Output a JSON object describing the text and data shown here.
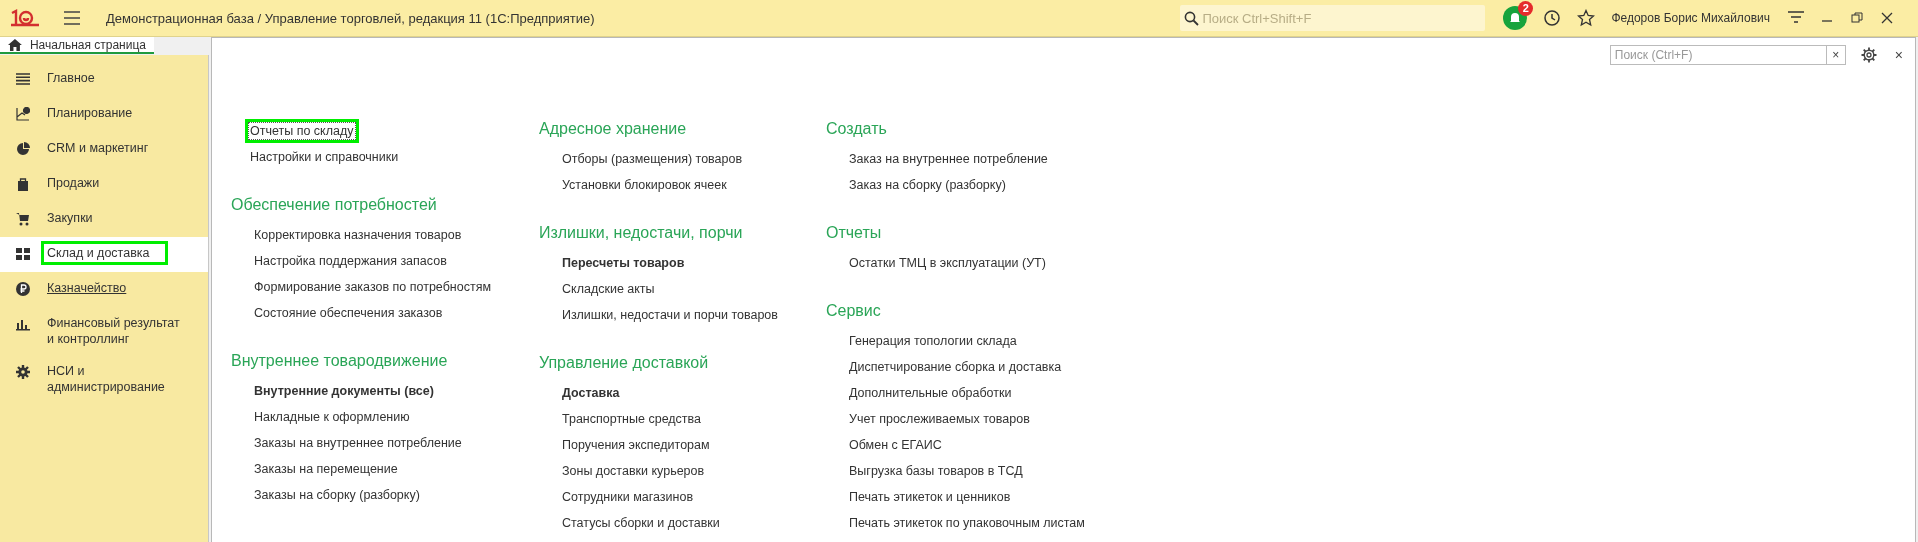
{
  "window": {
    "title": "Демонстрационная база / Управление торговлей, редакция 11  (1С:Предприятие)",
    "search_placeholder": "Поиск Ctrl+Shift+F",
    "notifications": "2",
    "user": "Федоров Борис Михайлович"
  },
  "home_tab": {
    "label": "Начальная страница",
    "selected": true
  },
  "sidebar": {
    "items": [
      {
        "label": "Главное",
        "selected": false,
        "highlighted": false,
        "underlined": false
      },
      {
        "label": "Планирование",
        "selected": false,
        "highlighted": false,
        "underlined": false
      },
      {
        "label": "CRM и маркетинг",
        "selected": false,
        "highlighted": false,
        "underlined": false
      },
      {
        "label": "Продажи",
        "selected": false,
        "highlighted": false,
        "underlined": false
      },
      {
        "label": "Закупки",
        "selected": false,
        "highlighted": false,
        "underlined": false
      },
      {
        "label": "Склад и доставка",
        "selected": true,
        "highlighted": true,
        "underlined": false
      },
      {
        "label": "Казначейство",
        "selected": false,
        "highlighted": false,
        "underlined": true
      },
      {
        "label": "Финансовый результат и контроллинг",
        "selected": false,
        "highlighted": false,
        "underlined": false
      },
      {
        "label": "НСИ и администрирование",
        "selected": false,
        "highlighted": false,
        "underlined": false
      }
    ]
  },
  "panel": {
    "search_placeholder": "Поиск (Ctrl+F)",
    "clear": "×",
    "close": "×",
    "columns": [
      [
        {
          "items": [
            {
              "label": "Отчеты по складу",
              "bold": false,
              "highlighted": true
            },
            {
              "label": "Настройки и справочники",
              "bold": false,
              "highlighted": false
            }
          ]
        },
        {
          "heading": "Обеспечение потребностей",
          "items": [
            {
              "label": "Корректировка назначения товаров",
              "bold": false,
              "highlighted": false
            },
            {
              "label": "Настройка поддержания запасов",
              "bold": false,
              "highlighted": false
            },
            {
              "label": "Формирование заказов по потребностям",
              "bold": false,
              "highlighted": false
            },
            {
              "label": "Состояние обеспечения заказов",
              "bold": false,
              "highlighted": false
            }
          ]
        },
        {
          "heading": "Внутреннее товародвижение",
          "items": [
            {
              "label": "Внутренние документы (все)",
              "bold": true,
              "highlighted": false
            },
            {
              "label": "Накладные к оформлению",
              "bold": false,
              "highlighted": false
            },
            {
              "label": "Заказы на внутреннее потребление",
              "bold": false,
              "highlighted": false
            },
            {
              "label": "Заказы на перемещение",
              "bold": false,
              "highlighted": false
            },
            {
              "label": "Заказы на сборку (разборку)",
              "bold": false,
              "highlighted": false
            }
          ]
        }
      ],
      [
        {
          "heading": "Адресное хранение",
          "items": [
            {
              "label": "Отборы (размещения) товаров",
              "bold": false,
              "highlighted": false
            },
            {
              "label": "Установки блокировок ячеек",
              "bold": false,
              "highlighted": false
            }
          ]
        },
        {
          "heading": "Излишки, недостачи, порчи",
          "items": [
            {
              "label": "Пересчеты товаров",
              "bold": true,
              "highlighted": false
            },
            {
              "label": "Складские акты",
              "bold": false,
              "highlighted": false
            },
            {
              "label": "Излишки, недостачи и порчи товаров",
              "bold": false,
              "highlighted": false
            }
          ]
        },
        {
          "heading": "Управление доставкой",
          "items": [
            {
              "label": "Доставка",
              "bold": true,
              "highlighted": false
            },
            {
              "label": "Транспортные средства",
              "bold": false,
              "highlighted": false
            },
            {
              "label": "Поручения экспедиторам",
              "bold": false,
              "highlighted": false
            },
            {
              "label": "Зоны доставки курьеров",
              "bold": false,
              "highlighted": false
            },
            {
              "label": "Сотрудники магазинов",
              "bold": false,
              "highlighted": false
            },
            {
              "label": "Статусы сборки и доставки",
              "bold": false,
              "highlighted": false
            }
          ]
        }
      ],
      [
        {
          "heading": "Создать",
          "items": [
            {
              "label": "Заказ на внутреннее потребление",
              "bold": false,
              "highlighted": false
            },
            {
              "label": "Заказ на сборку (разборку)",
              "bold": false,
              "highlighted": false
            }
          ]
        },
        {
          "heading": "Отчеты",
          "items": [
            {
              "label": "Остатки ТМЦ в эксплуатации (УТ)",
              "bold": false,
              "highlighted": false
            }
          ]
        },
        {
          "heading": "Сервис",
          "items": [
            {
              "label": "Генерация топологии склада",
              "bold": false,
              "highlighted": false
            },
            {
              "label": "Диспетчирование сборка и доставка",
              "bold": false,
              "highlighted": false
            },
            {
              "label": "Дополнительные обработки",
              "bold": false,
              "highlighted": false
            },
            {
              "label": "Учет прослеживаемых товаров",
              "bold": false,
              "highlighted": false
            },
            {
              "label": "Обмен с ЕГАИС",
              "bold": false,
              "highlighted": false
            },
            {
              "label": "Выгрузка базы товаров в ТСД",
              "bold": false,
              "highlighted": false
            },
            {
              "label": "Печать этикеток и ценников",
              "bold": false,
              "highlighted": false
            },
            {
              "label": "Печать этикеток по упаковочным листам",
              "bold": false,
              "highlighted": false
            }
          ]
        }
      ]
    ]
  }
}
